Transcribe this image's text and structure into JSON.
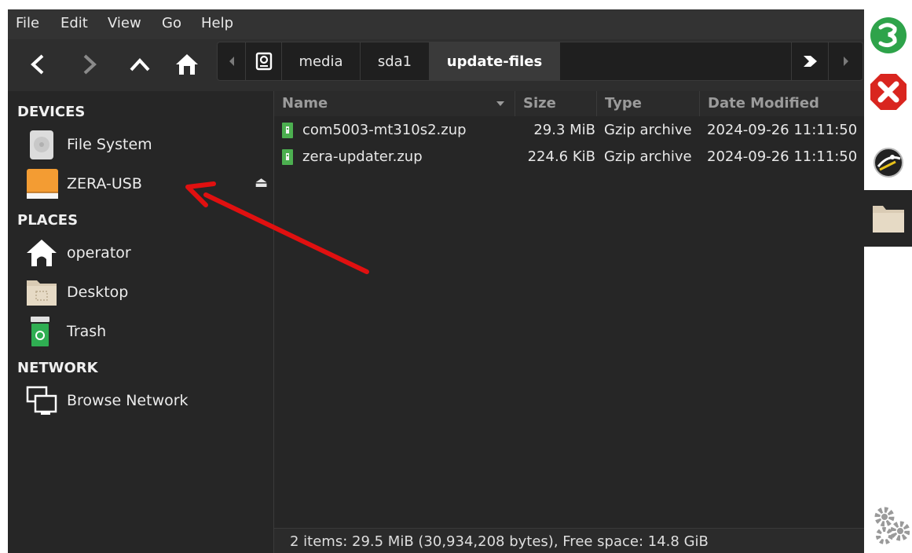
{
  "menu": [
    "File",
    "Edit",
    "View",
    "Go",
    "Help"
  ],
  "path": {
    "segments": [
      "media",
      "sda1",
      "update-files"
    ],
    "active_index": 2
  },
  "sidebar": {
    "sections": [
      {
        "title": "DEVICES",
        "items": [
          {
            "label": "File System",
            "icon": "harddisk-icon"
          },
          {
            "label": "ZERA-USB",
            "icon": "usb-drive-icon",
            "eject": "⏏"
          }
        ]
      },
      {
        "title": "PLACES",
        "items": [
          {
            "label": "operator",
            "icon": "home-folder-icon"
          },
          {
            "label": "Desktop",
            "icon": "desktop-folder-icon"
          },
          {
            "label": "Trash",
            "icon": "trash-icon"
          }
        ]
      },
      {
        "title": "NETWORK",
        "items": [
          {
            "label": "Browse Network",
            "icon": "network-icon"
          }
        ]
      }
    ]
  },
  "columns": {
    "name": "Name",
    "size": "Size",
    "type": "Type",
    "date": "Date Modified"
  },
  "files": [
    {
      "name": "com5003-mt310s2.zup",
      "size": "29.3 MiB",
      "type": "Gzip archive",
      "date": "2024-09-26 11:11:50"
    },
    {
      "name": "zera-updater.zup",
      "size": "224.6 KiB",
      "type": "Gzip archive",
      "date": "2024-09-26 11:11:50"
    }
  ],
  "status": "2 items: 29.5 MiB (30,934,208 bytes), Free space: 14.8 GiB",
  "colors": {
    "background": "#262626",
    "annotation_arrow": "#e01010",
    "usb_drive": "#f39c33",
    "close_button": "#d9251f"
  }
}
